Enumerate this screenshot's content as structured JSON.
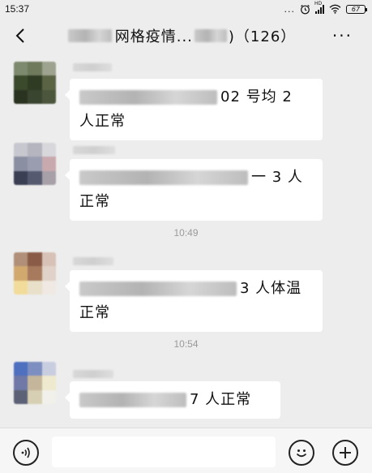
{
  "status_bar": {
    "time": "15:37",
    "dots": "...",
    "signal_label": "HD",
    "battery": "67"
  },
  "header": {
    "title_text": "网格疫情...",
    "member_count": ")（126）",
    "more_label": "···"
  },
  "messages": [
    {
      "line1_visible": "02 号均 2",
      "line2": "人正常"
    },
    {
      "line1_visible": "一 3 人",
      "line2": "正常"
    },
    {
      "line1_visible": "3 人体温",
      "line2": "正常"
    },
    {
      "line1_visible": "7 人正常",
      "line2": ""
    }
  ],
  "time_separators": [
    "10:49",
    "10:54"
  ],
  "input": {
    "value": "",
    "placeholder": ""
  },
  "icons": [
    "back-arrow-icon",
    "more-icon",
    "voice-icon",
    "emoji-icon",
    "plus-icon"
  ]
}
